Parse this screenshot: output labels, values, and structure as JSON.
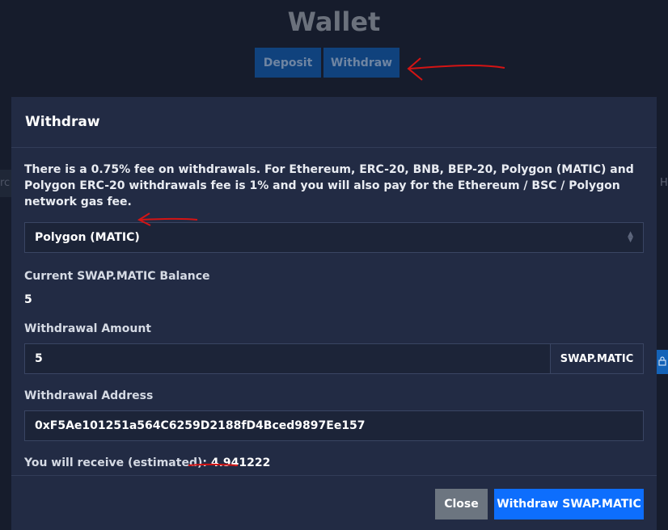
{
  "page": {
    "title": "Wallet",
    "tabs": {
      "deposit": "Deposit",
      "withdraw": "Withdraw"
    },
    "edge_left_text": "rc",
    "edge_right_text": "H"
  },
  "modal": {
    "title": "Withdraw",
    "notice": "There is a 0.75% fee on withdrawals. For Ethereum, ERC-20, BNB, BEP-20, Polygon (MATIC) and Polygon ERC-20 withdrawals fee is 1% and you will also pay for the Ethereum / BSC / Polygon network gas fee.",
    "network_select": {
      "selected": "Polygon (MATIC)"
    },
    "balance": {
      "label": "Current SWAP.MATIC Balance",
      "value": "5"
    },
    "amount": {
      "label": "Withdrawal Amount",
      "value": "5",
      "unit": "SWAP.MATIC"
    },
    "address": {
      "label": "Withdrawal Address",
      "value": "0xF5Ae101251a564C6259D2188fD4Bced9897Ee157"
    },
    "receive": {
      "label": "You will receive (estimated): ",
      "value": "4.941222"
    },
    "buttons": {
      "close": "Close",
      "withdraw": "Withdraw SWAP.MATIC"
    }
  },
  "colors": {
    "accent": "#0d6efd",
    "modal_bg": "#222b44",
    "page_bg": "#161c2c",
    "annotation": "#d41414"
  }
}
